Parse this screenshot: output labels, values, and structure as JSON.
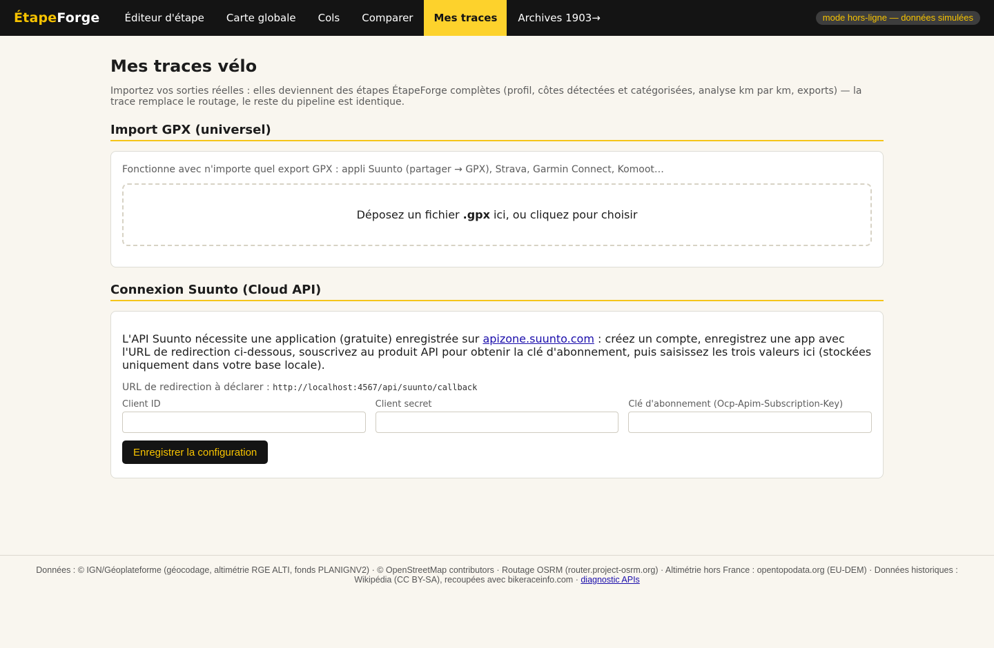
{
  "brand": {
    "part1": "Étape",
    "part2": "Forge"
  },
  "nav": {
    "items": [
      {
        "label": "Éditeur d'étape"
      },
      {
        "label": "Carte globale"
      },
      {
        "label": "Cols"
      },
      {
        "label": "Comparer"
      },
      {
        "label": "Mes traces",
        "active": true
      },
      {
        "label": "Archives 1903→"
      }
    ]
  },
  "status_badge": "mode hors-ligne — données simulées",
  "page": {
    "title": "Mes traces vélo",
    "lead": "Importez vos sorties réelles : elles deviennent des étapes ÉtapeForge complètes (profil, côtes détectées et catégorisées, analyse km par km, exports) — la trace remplace le routage, le reste du pipeline est identique."
  },
  "gpx": {
    "title": "Import GPX (universel)",
    "hint": "Fonctionne avec n'importe quel export GPX : appli Suunto (partager → GPX), Strava, Garmin Connect, Komoot…",
    "drop_before": "Déposez un fichier",
    "drop_ext": ".gpx",
    "drop_after": "ici, ou cliquez pour choisir"
  },
  "suunto": {
    "title": "Connexion Suunto (Cloud API)",
    "text_before": "L'API Suunto nécessite une application (gratuite) enregistrée sur",
    "link": "apizone.suunto.com",
    "text_after": ": créez un compte, enregistrez une app avec l'URL de redirection ci-dessous, souscrivez au produit API pour obtenir la clé d'abonnement, puis saisissez les trois valeurs ici (stockées uniquement dans votre base locale).",
    "redirect_label": "URL de redirection à déclarer :",
    "redirect_url": "http://localhost:4567/api/suunto/callback",
    "fields": {
      "client_id": {
        "label": "Client ID",
        "value": ""
      },
      "client_secret": {
        "label": "Client secret",
        "value": ""
      },
      "subscription_key": {
        "label": "Clé d'abonnement (Ocp-Apim-Subscription-Key)",
        "value": ""
      }
    },
    "save_label": "Enregistrer la configuration"
  },
  "footer": {
    "text": "Données : © IGN/Géoplateforme (géocodage, altimétrie RGE ALTI, fonds PLANIGNV2) · © OpenStreetMap contributors · Routage OSRM (router.project-osrm.org) · Altimétrie hors France : opentopodata.org (EU-DEM) · Données historiques : Wikipédia (CC BY-SA), recoupées avec bikeraceinfo.com ·",
    "link": "diagnostic APIs"
  },
  "colors": {
    "accent": "#fdd22c",
    "topbar": "#141414",
    "background": "#f9f6ef"
  }
}
